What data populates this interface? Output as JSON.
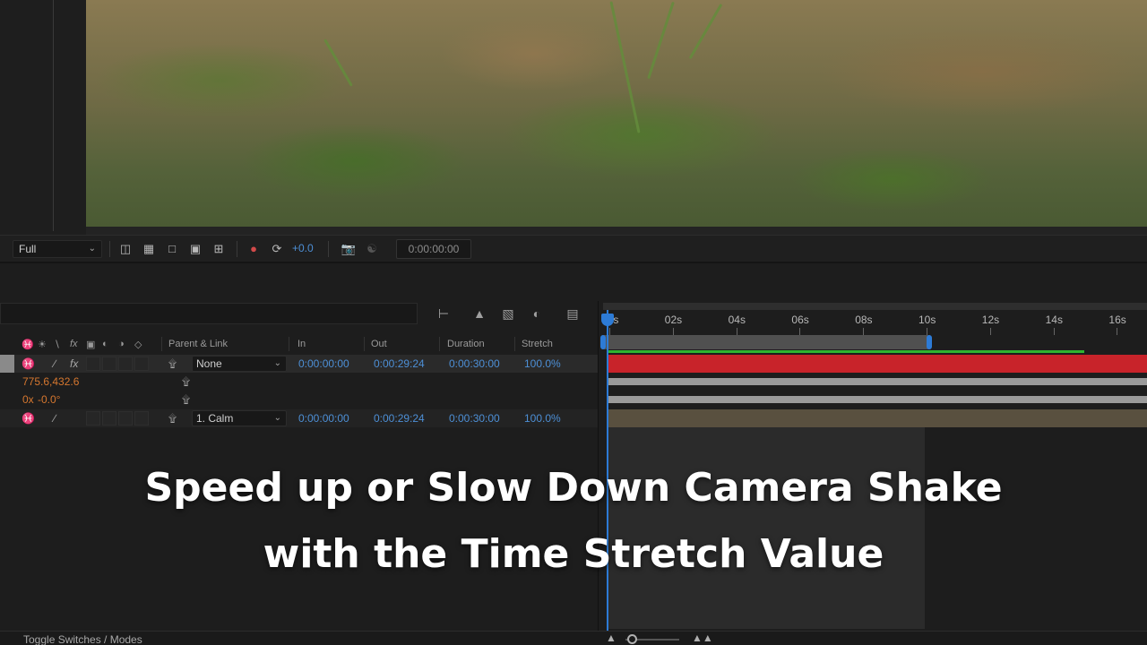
{
  "viewer": {
    "resolution": "Full",
    "exposure": "+0.0",
    "timecode": "0:00:00:00"
  },
  "columns": {
    "parent_link": "Parent & Link",
    "in": "In",
    "out": "Out",
    "duration": "Duration",
    "stretch": "Stretch"
  },
  "layers": [
    {
      "parent": "None",
      "in": "0:00:00:00",
      "out": "0:00:29:24",
      "duration": "0:00:30:00",
      "stretch": "100.0%"
    },
    {
      "parent": "1. Calm",
      "in": "0:00:00:00",
      "out": "0:00:29:24",
      "duration": "0:00:30:00",
      "stretch": "100.0%"
    }
  ],
  "properties": {
    "position": "775.6,432.6",
    "rotation_rev": "0x",
    "rotation_deg": "-0.0°"
  },
  "ruler": {
    "ticks": [
      "00s",
      "02s",
      "04s",
      "06s",
      "08s",
      "10s",
      "12s",
      "14s",
      "16s"
    ]
  },
  "footer": {
    "toggle_label": "Toggle Switches / Modes"
  },
  "caption": {
    "line1": "Speed up or Slow Down Camera Shake",
    "line2": "with the Time Stretch Value"
  },
  "colors": {
    "accent_blue": "#2d7bd6",
    "value_blue": "#4d8fd6",
    "layer_red": "#c8232a",
    "green_bar": "#2fb52f",
    "tan_bar": "#59503f",
    "orange_value": "#d6772f"
  }
}
